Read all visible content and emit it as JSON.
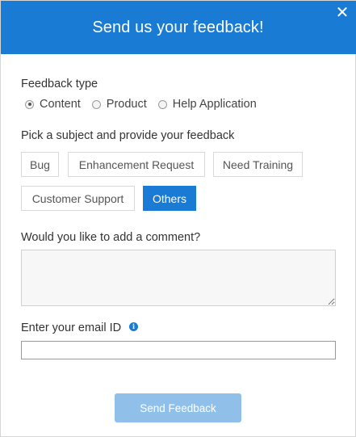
{
  "header": {
    "title": "Send us your feedback!",
    "close_icon": "close-icon"
  },
  "feedback_type": {
    "label": "Feedback type",
    "options": [
      {
        "label": "Content",
        "selected": true
      },
      {
        "label": "Product",
        "selected": false
      },
      {
        "label": "Help Application",
        "selected": false
      }
    ]
  },
  "subject": {
    "label": "Pick a subject and provide your feedback",
    "chips": [
      {
        "label": "Bug",
        "active": false
      },
      {
        "label": "Enhancement Request",
        "active": false
      },
      {
        "label": "Need Training",
        "active": false
      },
      {
        "label": "Customer Support",
        "active": false
      },
      {
        "label": "Others",
        "active": true
      }
    ]
  },
  "comment": {
    "label": "Would you like to add a comment?",
    "value": ""
  },
  "email": {
    "label": "Enter your email ID",
    "value": "",
    "info_icon": "info-icon"
  },
  "submit": {
    "label": "Send Feedback"
  },
  "colors": {
    "accent": "#1a7bd4",
    "button_disabled": "#90c0ea"
  }
}
